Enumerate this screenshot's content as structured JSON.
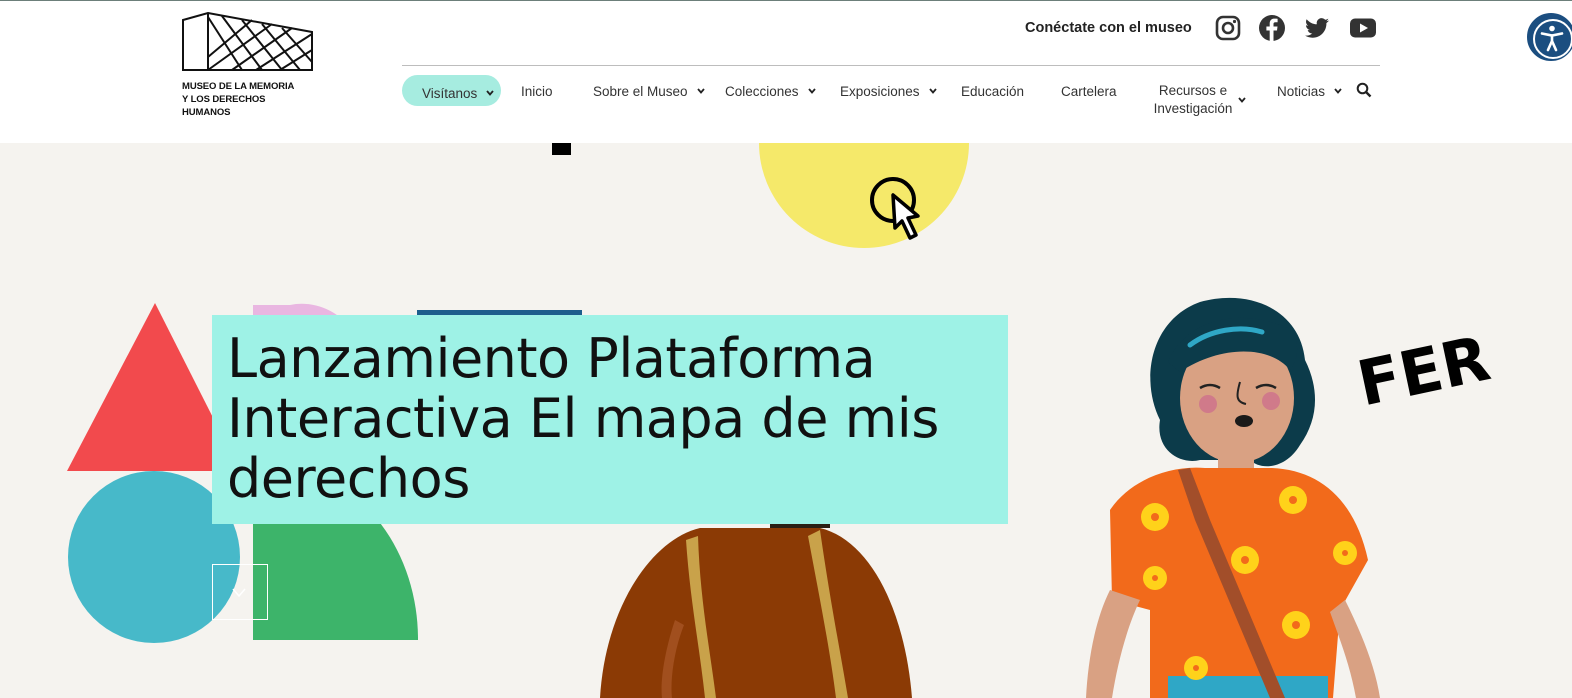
{
  "header": {
    "logo": {
      "line1_prefix": "MUSEO DE LA ",
      "line1_bold": "MEMORIA",
      "line2_prefix": "Y LOS ",
      "line2_bold": "DERECHOS",
      "line3": "HUMANOS"
    },
    "connect_label": "Conéctate con el museo",
    "social": [
      {
        "icon": "instagram-icon"
      },
      {
        "icon": "facebook-icon"
      },
      {
        "icon": "twitter-icon"
      },
      {
        "icon": "youtube-icon"
      }
    ]
  },
  "nav": {
    "visitanos": "Visítanos",
    "inicio": "Inicio",
    "sobre": "Sobre el Museo",
    "colecciones": "Colecciones",
    "exposiciones": "Exposiciones",
    "educacion": "Educación",
    "cartelera": "Cartelera",
    "recursos_line1": "Recursos e",
    "recursos_line2": "Investigación",
    "noticias": "Noticias",
    "active_color": "#a6ece0"
  },
  "hero": {
    "title": "Lanzamiento Plataforma Interactiva El mapa de mis derechos",
    "fer_text": "FER",
    "colors": {
      "title_bg": "#9ef2e6",
      "triangle": "#f24a4d",
      "circle_teal": "#47b9c9",
      "green": "#3db46a",
      "yellow": "#f5e96a",
      "orange_shirt": "#f26a1b",
      "hair": "#0c3b4a"
    }
  },
  "accessibility": {
    "icon": "accessibility-icon"
  }
}
